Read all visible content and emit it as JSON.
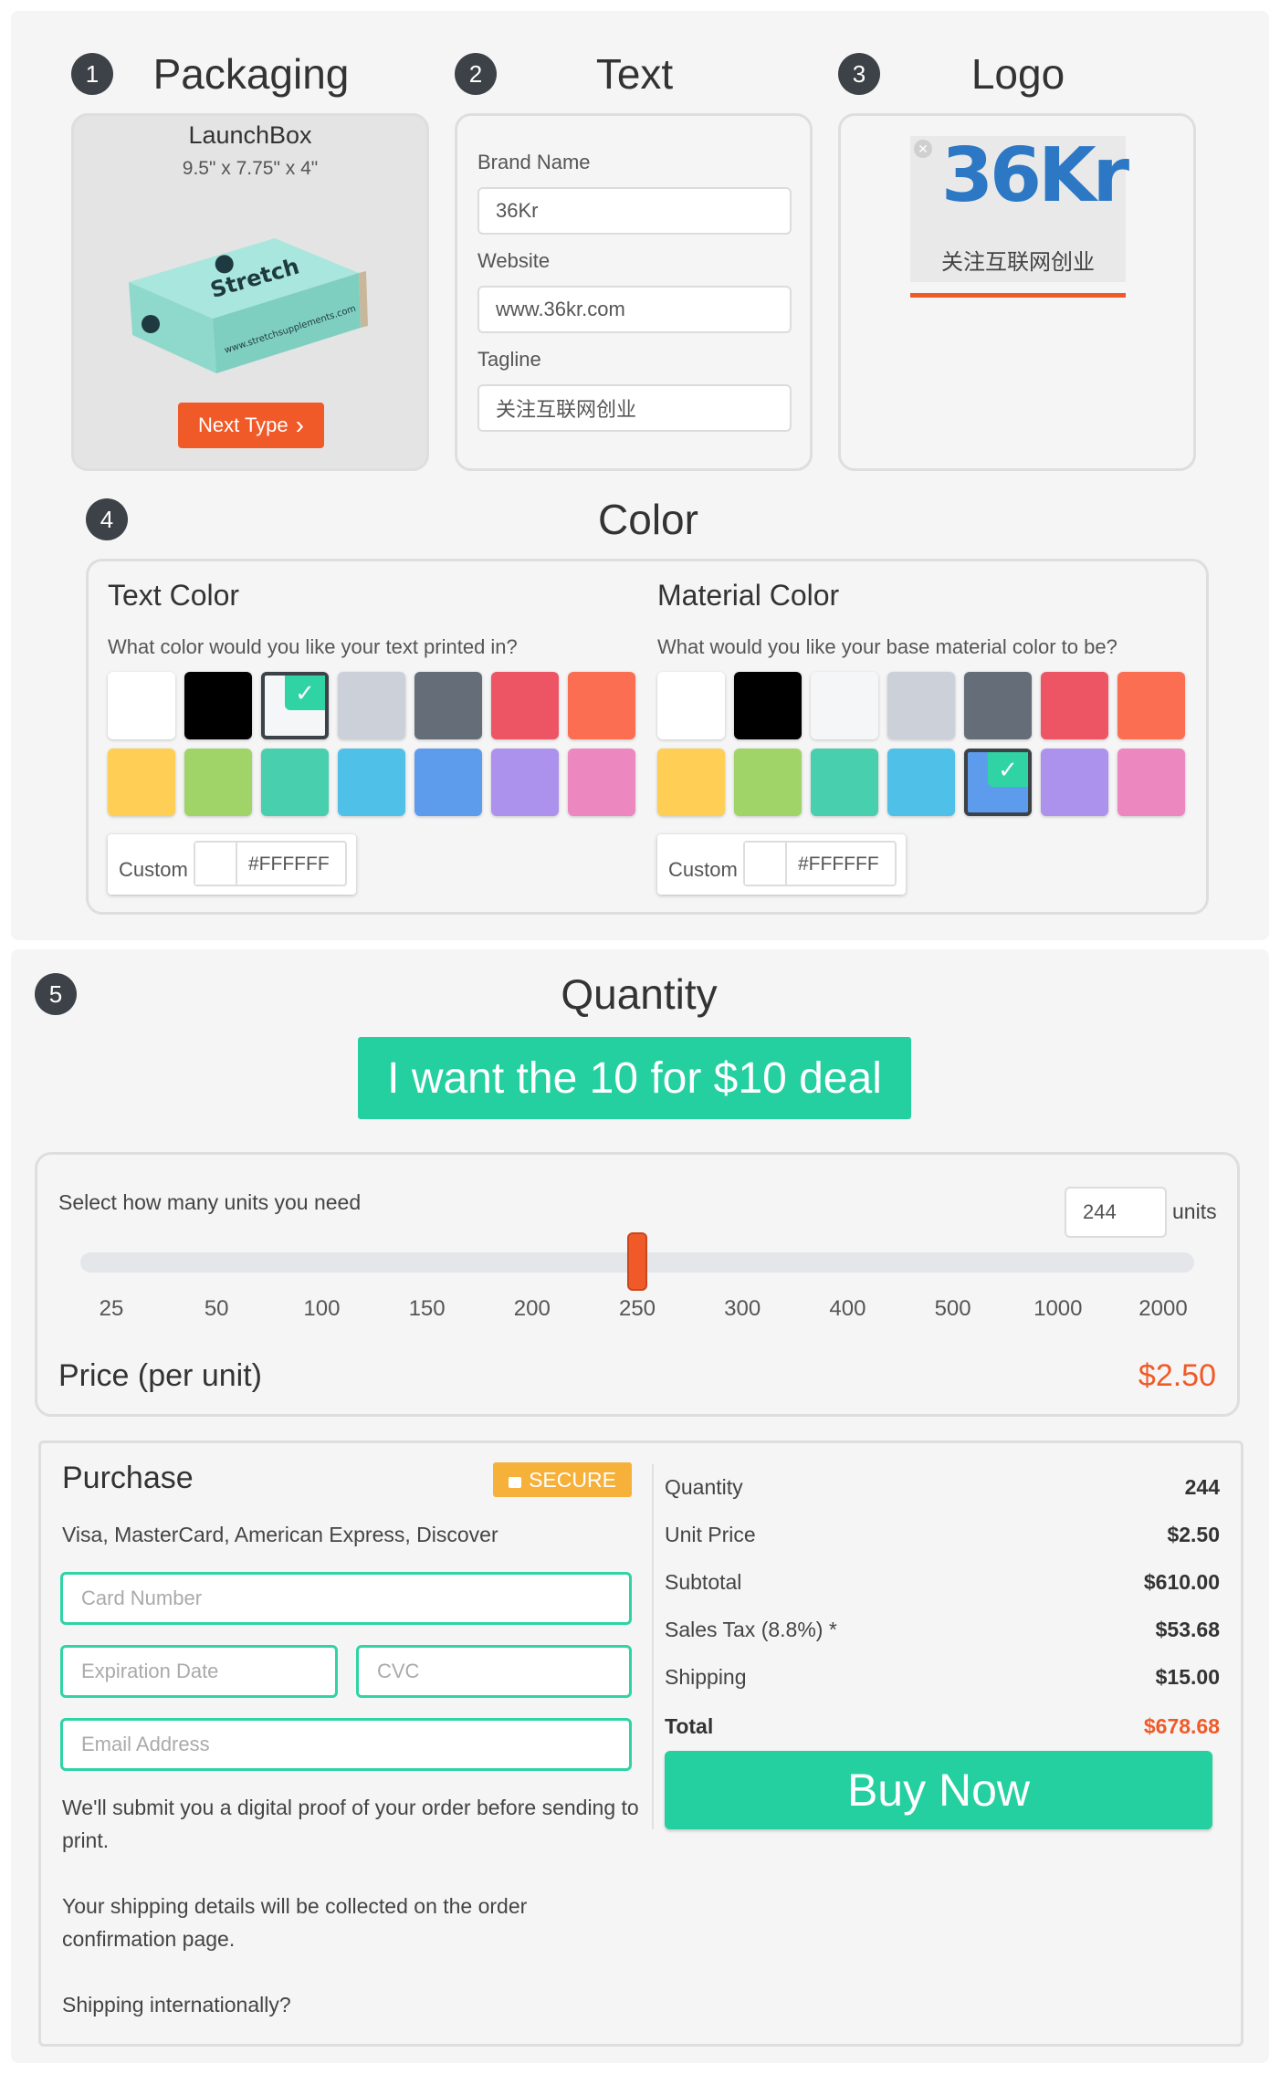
{
  "steps": {
    "packaging": {
      "number": "1",
      "title": "Packaging",
      "product_name": "LaunchBox",
      "dimensions": "9.5\" x 7.75\" x 4\"",
      "box_brand": "Stretch",
      "box_url": "www.stretchsupplements.com",
      "next_button": "Next Type"
    },
    "text": {
      "number": "2",
      "title": "Text",
      "fields": [
        {
          "label": "Brand Name",
          "value": "36Kr"
        },
        {
          "label": "Website",
          "value": "www.36kr.com"
        },
        {
          "label": "Tagline",
          "value": "关注互联网创业"
        }
      ]
    },
    "logo": {
      "number": "3",
      "title": "Logo",
      "logo_text": "36Kr",
      "logo_tagline": "关注互联网创业"
    },
    "color": {
      "number": "4",
      "title": "Color",
      "text_color": {
        "title": "Text Color",
        "question": "What color would you like your text printed in?",
        "selected_index": 2,
        "custom_label": "Custom",
        "custom_value": "#FFFFFF"
      },
      "material_color": {
        "title": "Material Color",
        "question": "What would you like your base material color to be?",
        "selected_index": 11,
        "custom_label": "Custom",
        "custom_value": "#FFFFFF"
      },
      "swatches": [
        "#ffffff",
        "#000000",
        "#f5f6f8",
        "#ccd1d9",
        "#656d78",
        "#ed5565",
        "#fc6e51",
        "#ffce54",
        "#a0d468",
        "#48cfad",
        "#4fc1e9",
        "#5d9cec",
        "#ac92ec",
        "#ec87c0"
      ]
    },
    "quantity": {
      "number": "5",
      "title": "Quantity",
      "deal_button": "I want the 10 for $10 deal",
      "select_label": "Select how many units you need",
      "units_value": "244",
      "units_label": "units",
      "slider_position": 0.5,
      "ticks": [
        "25",
        "50",
        "100",
        "150",
        "200",
        "250",
        "300",
        "400",
        "500",
        "1000",
        "2000"
      ],
      "price_label": "Price (per unit)",
      "price_value": "$2.50"
    }
  },
  "purchase": {
    "title": "Purchase",
    "secure_badge": "SECURE",
    "cards_accepted": "Visa, MasterCard, American Express, Discover",
    "placeholders": {
      "card": "Card Number",
      "expiry": "Expiration Date",
      "cvc": "CVC",
      "email": "Email Address"
    },
    "notes": [
      "We'll submit you a digital proof of your order before sending to print.",
      "Your shipping details will be collected on the order confirmation page.",
      "Shipping internationally?"
    ],
    "summary": [
      {
        "label": "Quantity",
        "value": "244"
      },
      {
        "label": "Unit Price",
        "value": "$2.50"
      },
      {
        "label": "Subtotal",
        "value": "$610.00"
      },
      {
        "label": "Sales Tax (8.8%) *",
        "value": "$53.68"
      },
      {
        "label": "Shipping",
        "value": "$15.00"
      }
    ],
    "total_label": "Total",
    "total_value": "$678.68",
    "buy_button": "Buy Now"
  },
  "colors": {
    "accent": "#2fd3a4",
    "orange": "#f05a28",
    "secure": "#f6b13b"
  }
}
